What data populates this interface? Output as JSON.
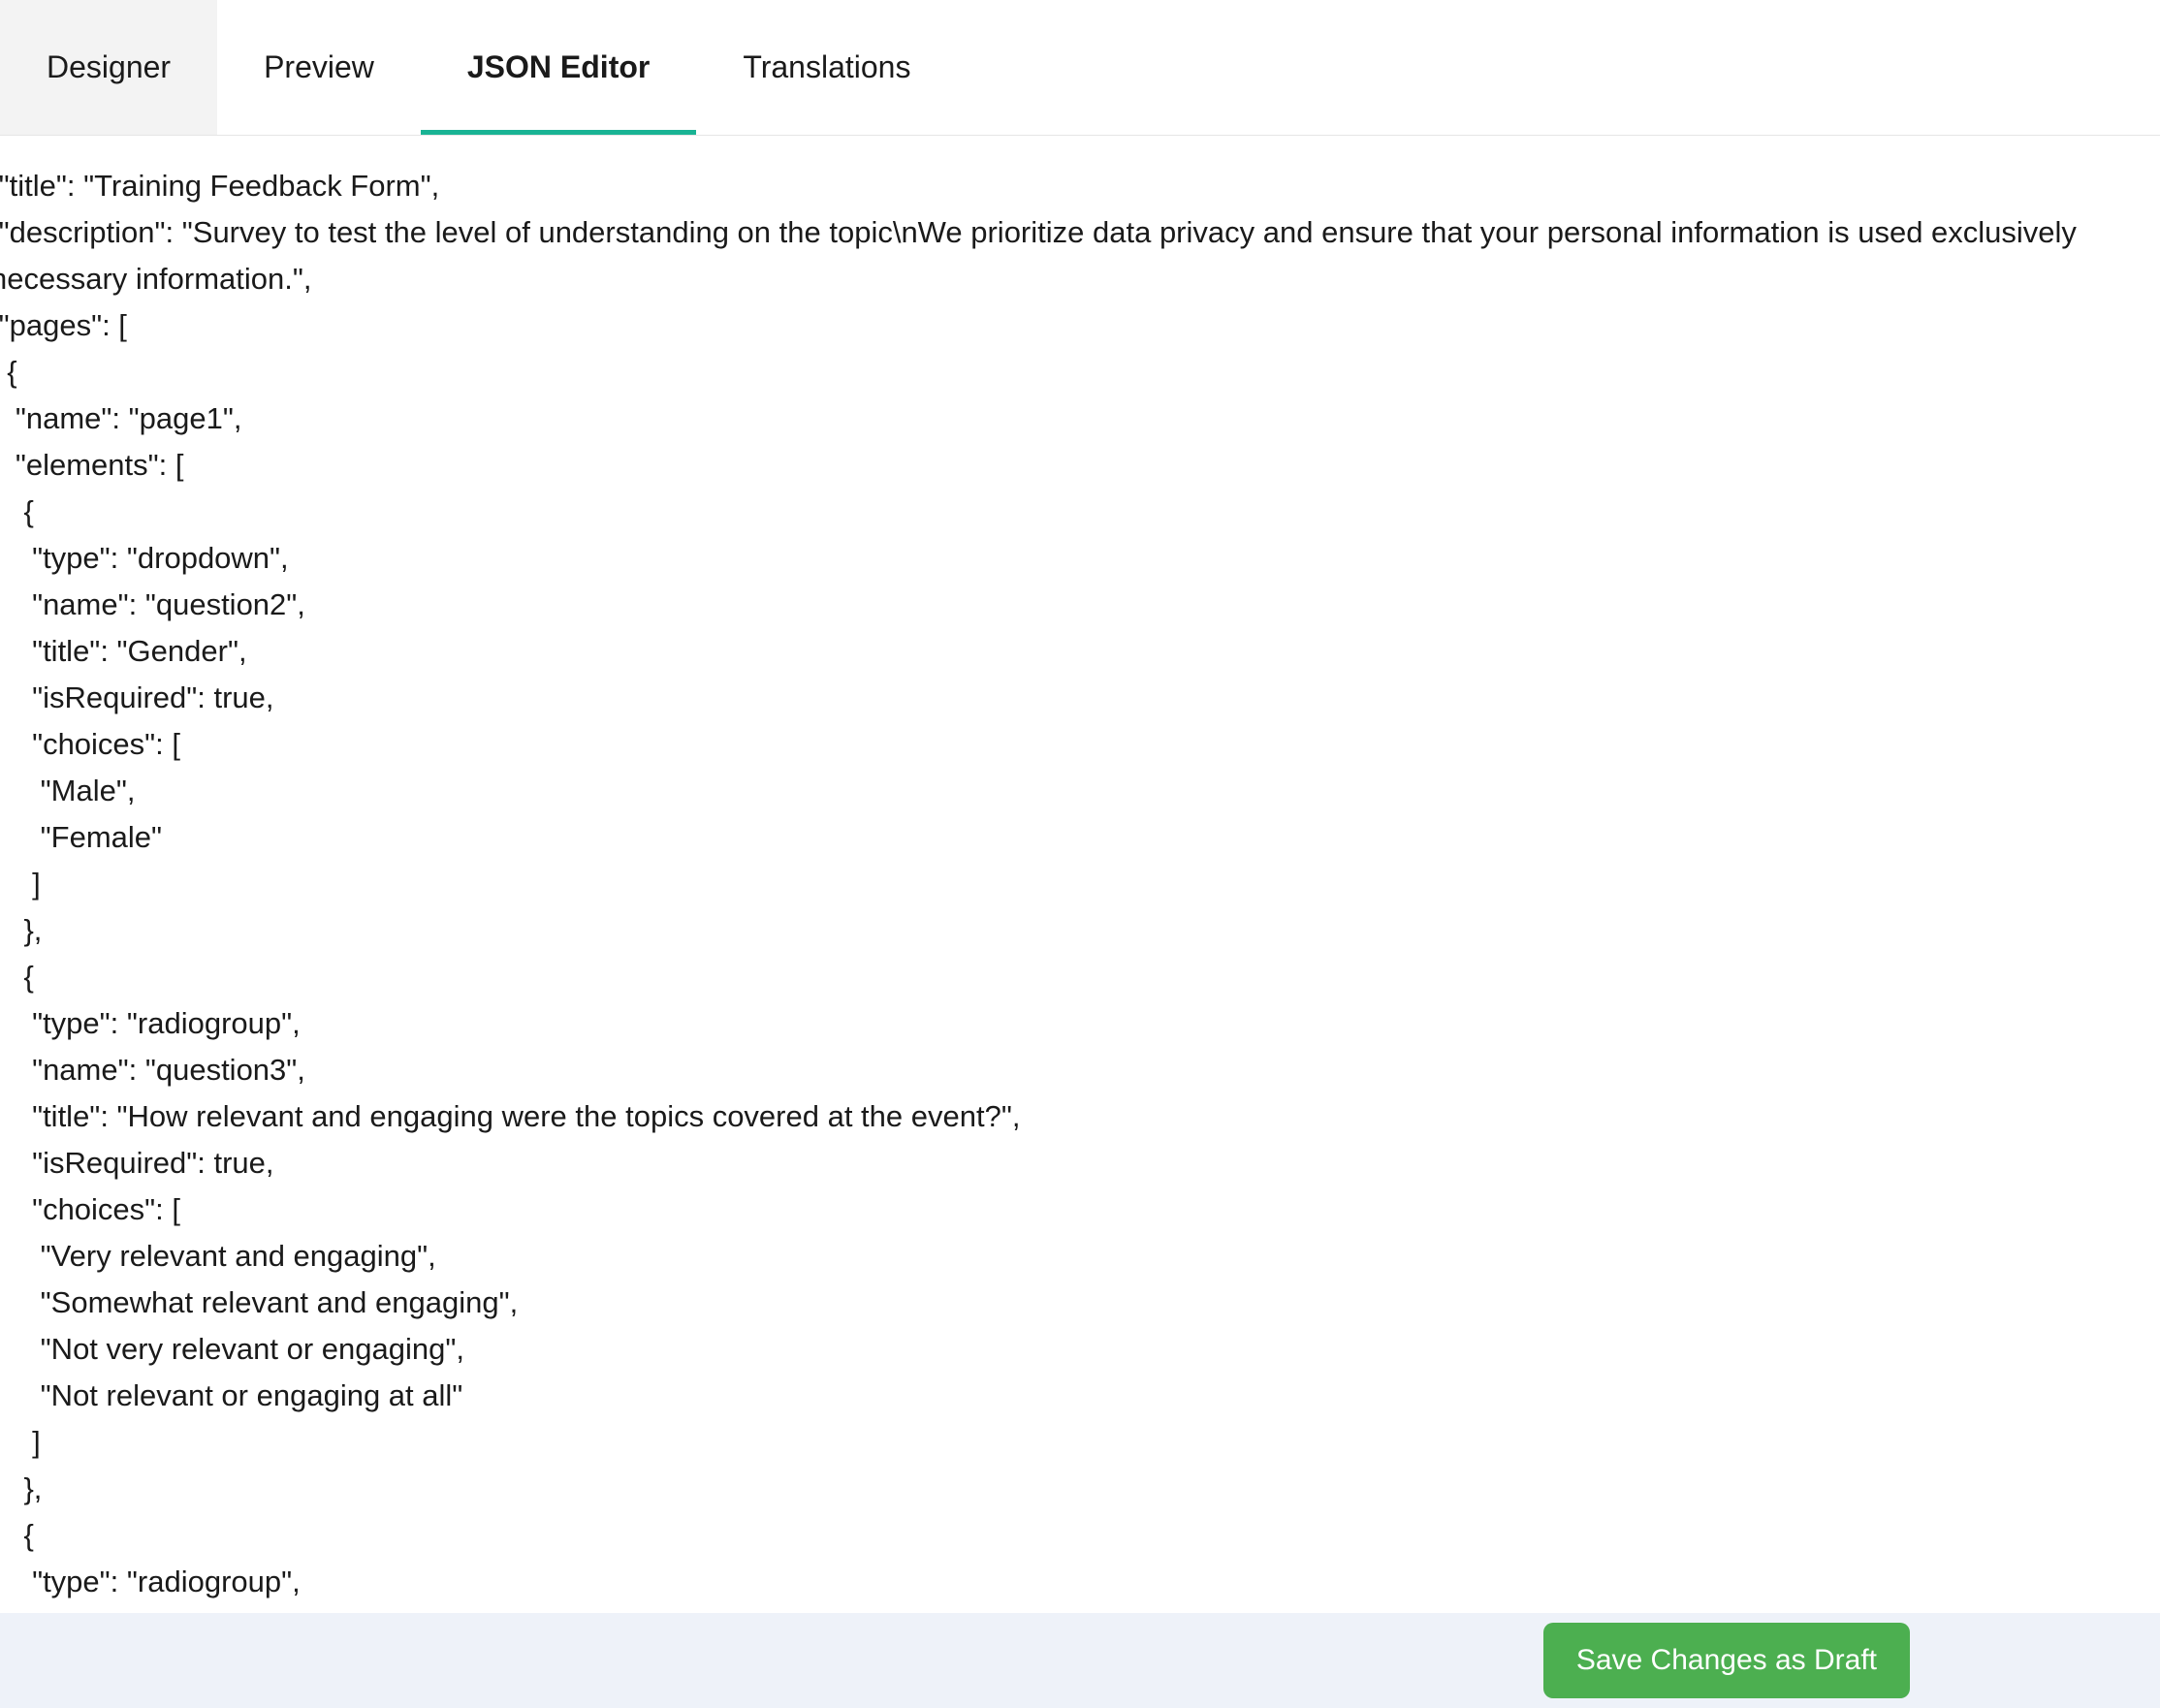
{
  "tabs": {
    "designer": "Designer",
    "preview": "Preview",
    "json_editor": "JSON Editor",
    "translations": "Translations",
    "active": "json_editor"
  },
  "editor": {
    "json_text": " \"title\": \"Training Feedback Form\",\n \"description\": \"Survey to test the level of understanding on the topic\\nWe prioritize data privacy and ensure that your personal information is used exclusively\nnecessary information.\",\n \"pages\": [\n  {\n   \"name\": \"page1\",\n   \"elements\": [\n    {\n     \"type\": \"dropdown\",\n     \"name\": \"question2\",\n     \"title\": \"Gender\",\n     \"isRequired\": true,\n     \"choices\": [\n      \"Male\",\n      \"Female\"\n     ]\n    },\n    {\n     \"type\": \"radiogroup\",\n     \"name\": \"question3\",\n     \"title\": \"How relevant and engaging were the topics covered at the event?\",\n     \"isRequired\": true,\n     \"choices\": [\n      \"Very relevant and engaging\",\n      \"Somewhat relevant and engaging\",\n      \"Not very relevant or engaging\",\n      \"Not relevant or engaging at all\"\n     ]\n    },\n    {\n     \"type\": \"radiogroup\","
  },
  "footer": {
    "save_draft_label": "Save Changes as Draft"
  },
  "survey_json": {
    "title": "Training Feedback Form",
    "description": "Survey to test the level of understanding on the topic\nWe prioritize data privacy and ensure that your personal information is used exclusively necessary information.",
    "pages": [
      {
        "name": "page1",
        "elements": [
          {
            "type": "dropdown",
            "name": "question2",
            "title": "Gender",
            "isRequired": true,
            "choices": [
              "Male",
              "Female"
            ]
          },
          {
            "type": "radiogroup",
            "name": "question3",
            "title": "How relevant and engaging were the topics covered at the event?",
            "isRequired": true,
            "choices": [
              "Very relevant and engaging",
              "Somewhat relevant and engaging",
              "Not very relevant or engaging",
              "Not relevant or engaging at all"
            ]
          },
          {
            "type": "radiogroup"
          }
        ]
      }
    ]
  }
}
